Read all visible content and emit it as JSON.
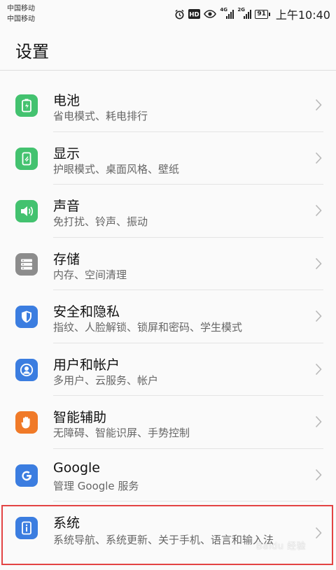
{
  "status_bar": {
    "carrier_1": "中国移动",
    "carrier_2": "中国移动",
    "net_1": "4G",
    "net_2": "2G",
    "hd": "HD",
    "battery": "91",
    "time": "上午10:40",
    "icons": [
      "alarm-icon",
      "hd-icon",
      "eye-icon",
      "signal-4g-icon",
      "signal-2g-icon",
      "battery-icon"
    ]
  },
  "page": {
    "title": "设置"
  },
  "items": [
    {
      "key": "battery",
      "title": "电池",
      "subtitle": "省电模式、耗电排行",
      "icon": "battery-icon",
      "color": "#43c26f"
    },
    {
      "key": "display",
      "title": "显示",
      "subtitle": "护眼模式、桌面风格、壁纸",
      "icon": "display-icon",
      "color": "#43c26f"
    },
    {
      "key": "sound",
      "title": "声音",
      "subtitle": "免打扰、铃声、振动",
      "icon": "speaker-icon",
      "color": "#43c26f"
    },
    {
      "key": "storage",
      "title": "存储",
      "subtitle": "内存、空间清理",
      "icon": "storage-icon",
      "color": "#8c8c8c"
    },
    {
      "key": "security",
      "title": "安全和隐私",
      "subtitle": "指纹、人脸解锁、锁屏和密码、学生模式",
      "icon": "shield-icon",
      "color": "#3b7de0"
    },
    {
      "key": "accounts",
      "title": "用户和帐户",
      "subtitle": "多用户、云服务、帐户",
      "icon": "user-icon",
      "color": "#3b7de0"
    },
    {
      "key": "assist",
      "title": "智能辅助",
      "subtitle": "无障碍、智能识屏、手势控制",
      "icon": "hand-icon",
      "color": "#f07a28"
    },
    {
      "key": "google",
      "title": "Google",
      "subtitle": "管理 Google 服务",
      "icon": "google-icon",
      "color": "#3b7de0"
    },
    {
      "key": "system",
      "title": "系统",
      "subtitle": "系统导航、系统更新、关于手机、语言和输入法",
      "icon": "info-icon",
      "color": "#3b7de0"
    }
  ],
  "watermark": "Baidu 经验"
}
